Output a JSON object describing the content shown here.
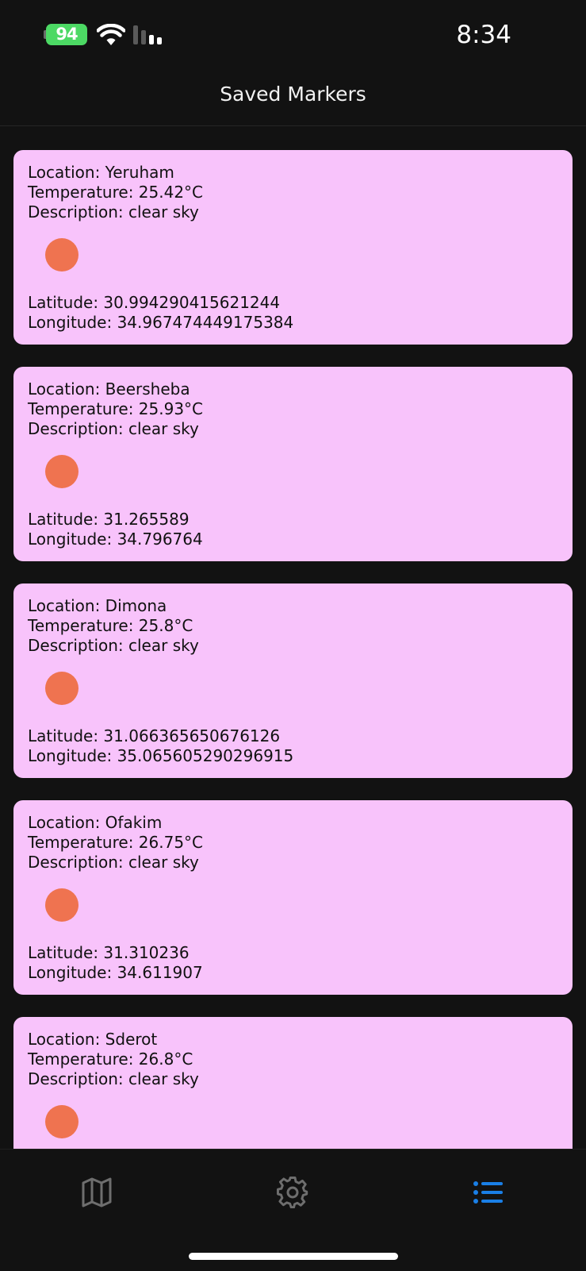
{
  "status_bar": {
    "battery": "94",
    "time": "8:34",
    "icons": [
      "battery-charging-icon",
      "wifi-icon",
      "cellular-signal-icon"
    ]
  },
  "header": {
    "title": "Saved Markers"
  },
  "colors": {
    "background": "#121212",
    "card": "#f8c3fb",
    "dot": "#ef7350",
    "active_tab": "#1a7fe6",
    "inactive_tab": "#6e6e6e",
    "battery": "#4cd964"
  },
  "markers": [
    {
      "location": "Location: Yeruham",
      "temperature": "Temperature: 25.42°C",
      "description": "Description: clear sky",
      "latitude": "Latitude: 30.994290415621244",
      "longitude": "Longitude: 34.967474449175384"
    },
    {
      "location": "Location: Beersheba",
      "temperature": "Temperature: 25.93°C",
      "description": "Description: clear sky",
      "latitude": "Latitude: 31.265589",
      "longitude": "Longitude: 34.796764"
    },
    {
      "location": "Location: Dimona",
      "temperature": "Temperature: 25.8°C",
      "description": "Description: clear sky",
      "latitude": "Latitude: 31.066365650676126",
      "longitude": "Longitude: 35.065605290296915"
    },
    {
      "location": "Location: Ofakim",
      "temperature": "Temperature: 26.75°C",
      "description": "Description: clear sky",
      "latitude": "Latitude: 31.310236",
      "longitude": "Longitude: 34.611907"
    },
    {
      "location": "Location: Sderot",
      "temperature": "Temperature: 26.8°C",
      "description": "Description: clear sky",
      "latitude": "",
      "longitude": ""
    }
  ],
  "tabs": [
    {
      "icon": "map-icon",
      "active": false
    },
    {
      "icon": "gear-icon",
      "active": false
    },
    {
      "icon": "list-icon",
      "active": true
    }
  ]
}
